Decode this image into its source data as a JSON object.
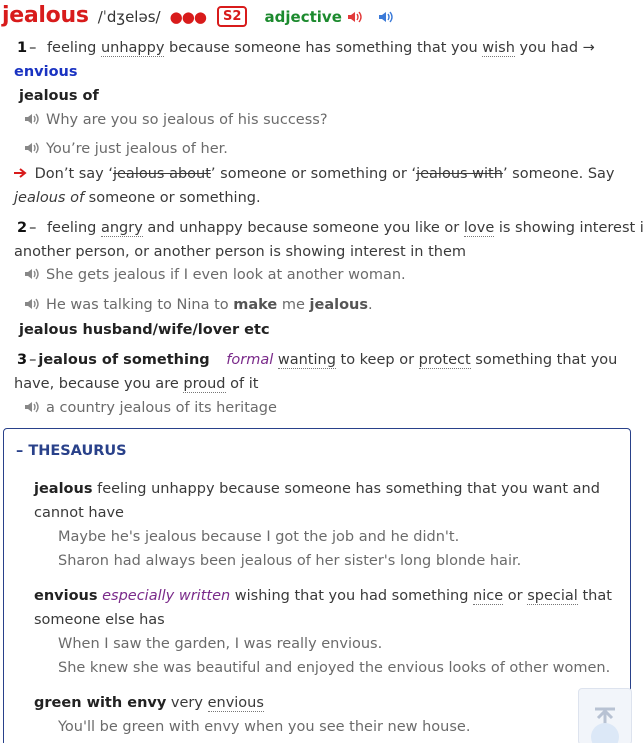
{
  "header": {
    "headword": "jealous",
    "pronunciation": "/ˈdʒeləs/",
    "frequency": "●●●",
    "level": "S2",
    "pos": "adjective",
    "icons": [
      "speaker-red-icon",
      "speaker-blue-icon"
    ]
  },
  "senses": [
    {
      "num": "1",
      "def_parts": [
        "feeling ",
        "unhappy",
        " because someone has something that you ",
        "wish",
        " you had →"
      ],
      "xref": "envious",
      "collocation": "jealous of",
      "examples": [
        "Why are you so jealous of his success?",
        "You’re just jealous of her."
      ],
      "note": {
        "prefix": "Don’t say ‘",
        "wrong1": "jealous about",
        "mid": "’ someone or something or ‘",
        "wrong2": "jealous with",
        "suffix": "’ someone. Say",
        "line2_ital": "jealous of",
        "line2_rest": " someone or something."
      }
    },
    {
      "num": "2",
      "def_line1_parts": [
        "feeling ",
        "angry",
        " and unhappy because someone you like or ",
        "love",
        " is showing interest in"
      ],
      "def_line2": "another person, or another person is showing interest in them",
      "examples": [
        "She gets jealous if I even look at another woman."
      ],
      "example2": {
        "pre": "He was talking to Nina to ",
        "b1": "make",
        "mid": " me ",
        "b2": "jealous",
        "post": "."
      },
      "collocation": "jealous husband/wife/lover etc"
    },
    {
      "num": "3",
      "phrase": "jealous of something",
      "register": "formal",
      "def_line1_parts": [
        "wanting",
        " to keep or ",
        "protect",
        " something that you"
      ],
      "def_line2_parts": [
        "have, because you are ",
        "proud",
        " of it"
      ],
      "examples": [
        "a country jealous of its heritage"
      ]
    }
  ],
  "thesaurus": {
    "title": "THESAURUS",
    "toggle": "–",
    "entries": [
      {
        "word": "jealous",
        "def_line1": " feeling unhappy because someone has something that you want and",
        "def_line2": "cannot have",
        "examples": [
          "Maybe he's jealous because I got the job and he didn't.",
          "Sharon had always been jealous of her sister's long blonde hair."
        ]
      },
      {
        "word": "envious",
        "register": "especially written",
        "def_line1_parts": [
          " wishing that you had something ",
          "nice",
          " or ",
          "special",
          " that"
        ],
        "def_line2": "someone else has",
        "examples": [
          "When I saw the garden, I was really envious.",
          "She knew she was beautiful and enjoyed the envious looks of other women."
        ]
      },
      {
        "word": "green with envy",
        "def_parts": [
          " very ",
          "envious"
        ],
        "examples": [
          "You'll be green with envy when you see their new house."
        ]
      }
    ]
  }
}
